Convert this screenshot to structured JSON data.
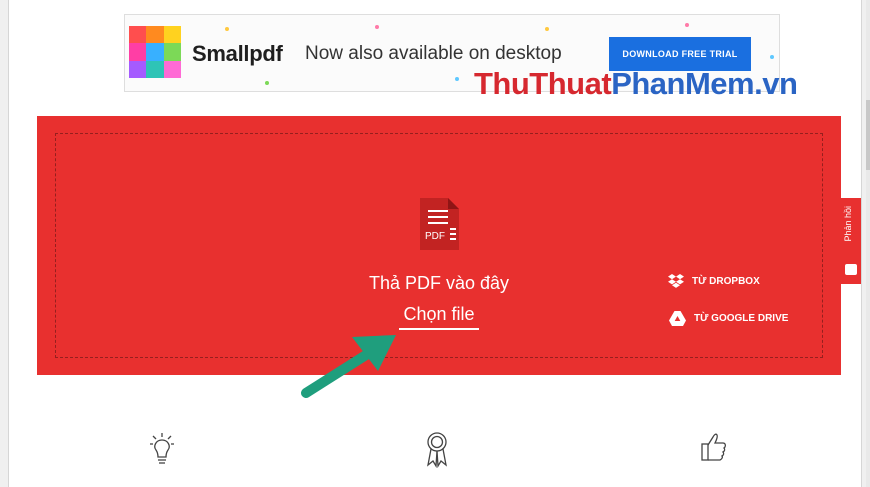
{
  "banner": {
    "brand": "Smallpdf",
    "tagline": "Now also available on desktop",
    "cta_label": "DOWNLOAD FREE TRIAL",
    "logo_colors": [
      "#ff4e4e",
      "#ff8a1f",
      "#ffd21f",
      "#ff3ea5",
      "#38b0ff",
      "#7cd957",
      "#a55bff",
      "#2ec4b6",
      "#ff6ad5"
    ]
  },
  "watermark": {
    "part1": "ThuThuat",
    "part2": "PhanMem.vn"
  },
  "dropzone": {
    "icon_label": "PDF",
    "drop_text": "Thả PDF vào đây",
    "choose_label": "Chọn file",
    "dropbox_label": "TỪ DROPBOX",
    "drive_label": "TỪ GOOGLE DRIVE",
    "background_color": "#e8302f"
  },
  "feedback": {
    "label": "Phản hồi"
  },
  "features": {
    "icons": [
      "lightbulb-icon",
      "award-ribbon-icon",
      "thumbs-up-icon"
    ]
  }
}
